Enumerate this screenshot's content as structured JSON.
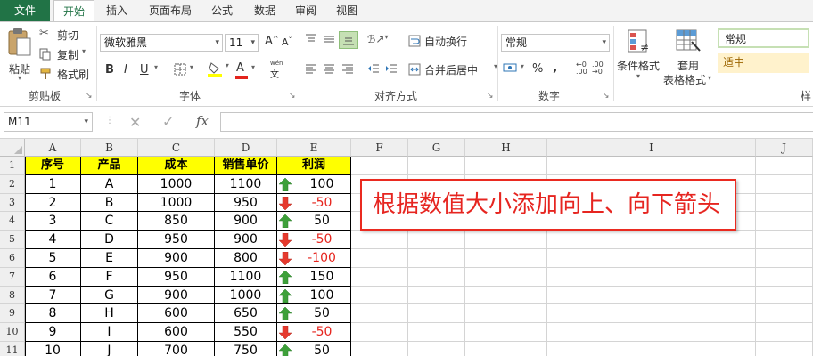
{
  "tabs": [
    "文件",
    "开始",
    "插入",
    "页面布局",
    "公式",
    "数据",
    "审阅",
    "视图"
  ],
  "clipboard": {
    "paste": "粘贴",
    "cut": "剪切",
    "copy": "复制",
    "format_painter": "格式刷",
    "group_label": "剪贴板"
  },
  "font": {
    "family": "微软雅黑",
    "size": "11",
    "bold": "B",
    "italic": "I",
    "underline": "U",
    "grow": "A",
    "shrink": "A",
    "font_color": "A",
    "wen": "wén",
    "group_label": "字体"
  },
  "alignment": {
    "wrap": "自动换行",
    "merge": "合并后居中",
    "group_label": "对齐方式"
  },
  "number": {
    "format": "常规",
    "percent": "%",
    "comma": ",",
    "group_label": "数字"
  },
  "styles": {
    "conditional": "条件格式",
    "table_line1": "套用",
    "table_line2": "表格格式",
    "style_normal": "常规",
    "style_medium": "适中",
    "group_label_partial": "样"
  },
  "formula_bar": {
    "name_box": "M11",
    "cancel": "✕",
    "enter": "✓",
    "fx": "fx",
    "value": ""
  },
  "columns": [
    "A",
    "B",
    "C",
    "D",
    "E",
    "F",
    "G",
    "H",
    "I",
    "J"
  ],
  "row_numbers": [
    "1",
    "2",
    "3",
    "4",
    "5",
    "6",
    "7",
    "8",
    "9",
    "10",
    "11"
  ],
  "table": {
    "headers": [
      "序号",
      "产品",
      "成本",
      "销售单价",
      "利润"
    ],
    "rows": [
      [
        "1",
        "A",
        "1000",
        "1100",
        "100",
        "up"
      ],
      [
        "2",
        "B",
        "1000",
        "950",
        "-50",
        "down"
      ],
      [
        "3",
        "C",
        "850",
        "900",
        "50",
        "up"
      ],
      [
        "4",
        "D",
        "950",
        "900",
        "-50",
        "down"
      ],
      [
        "5",
        "E",
        "900",
        "800",
        "-100",
        "down"
      ],
      [
        "6",
        "F",
        "950",
        "1100",
        "150",
        "up"
      ],
      [
        "7",
        "G",
        "900",
        "1000",
        "100",
        "up"
      ],
      [
        "8",
        "H",
        "600",
        "650",
        "50",
        "up"
      ],
      [
        "9",
        "I",
        "600",
        "550",
        "-50",
        "down"
      ],
      [
        "10",
        "J",
        "700",
        "750",
        "50",
        "up"
      ]
    ]
  },
  "callout": "根据数值大小添加向上、向下箭头",
  "colors": {
    "accent": "#217346",
    "header_fill": "#ffff00",
    "up_arrow": "#3ea03a",
    "down_arrow": "#e63a2e",
    "negative_text": "#e6241d",
    "callout_border": "#ea2a20"
  }
}
